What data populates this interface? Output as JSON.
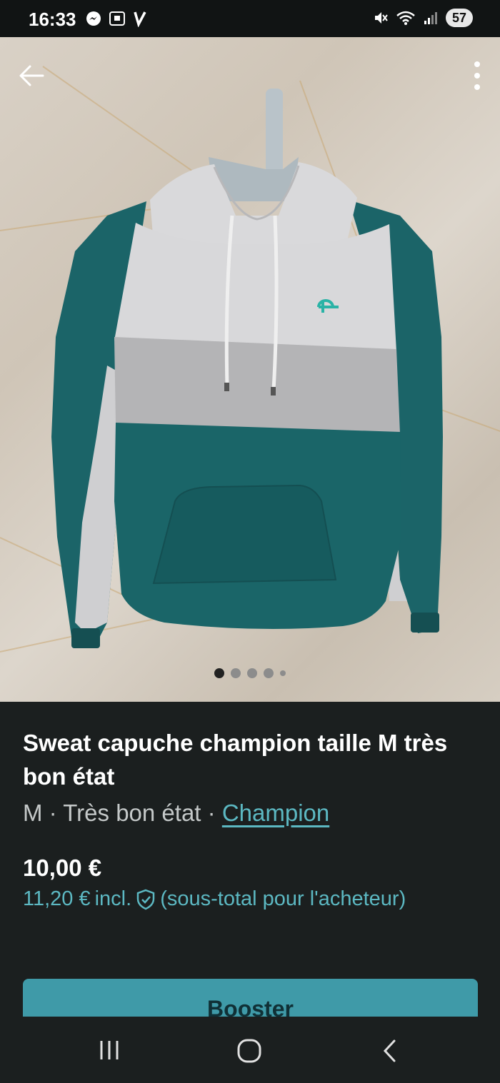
{
  "status_bar": {
    "time": "16:33",
    "battery": "57",
    "left_icons": [
      "messenger-icon",
      "screenshot-icon",
      "app-v-icon"
    ],
    "right_icons": [
      "mute-icon",
      "wifi-icon",
      "signal-icon"
    ]
  },
  "photo": {
    "back_icon": "arrow-left-icon",
    "more_icon": "more-vertical-icon",
    "image_count": 5,
    "active_index": 0
  },
  "listing": {
    "title": "Sweat capuche champion taille M très bon état",
    "size": "M",
    "separator": "·",
    "condition": "Très bon état",
    "brand": "Champion",
    "price": "10,00 €",
    "buyer_price": "11,20 €",
    "buyer_incl": "incl.",
    "buyer_note": "(sous-total pour l'acheteur)"
  },
  "actions": {
    "boost_label": "Booster"
  },
  "colors": {
    "accent": "#5cb8c2",
    "button": "#3f9aa8",
    "background": "#1b1f1f"
  }
}
